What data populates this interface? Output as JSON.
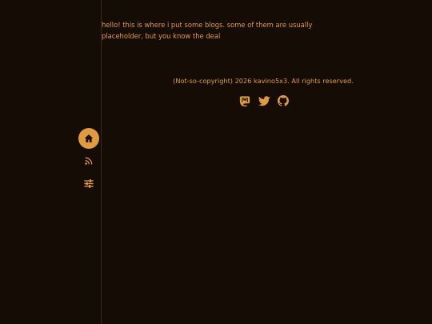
{
  "intro": {
    "text": "hello! this is where i put some blogs. some of them are usually placeholder, but you know the deal"
  },
  "footer": {
    "copyright": "(Not-so-copyright) 2026 kavino5x3. All rights reserved."
  },
  "socials": [
    {
      "icon": "mastodon-icon"
    },
    {
      "icon": "twitter-icon"
    },
    {
      "icon": "github-icon"
    }
  ],
  "nav": [
    {
      "icon": "home-icon",
      "active": true
    },
    {
      "icon": "rss-icon",
      "active": false
    },
    {
      "icon": "settings-sliders-icon",
      "active": false
    }
  ],
  "colors": {
    "background": "#140c05",
    "accent": "#e09a40",
    "divider": "#3a2916"
  }
}
